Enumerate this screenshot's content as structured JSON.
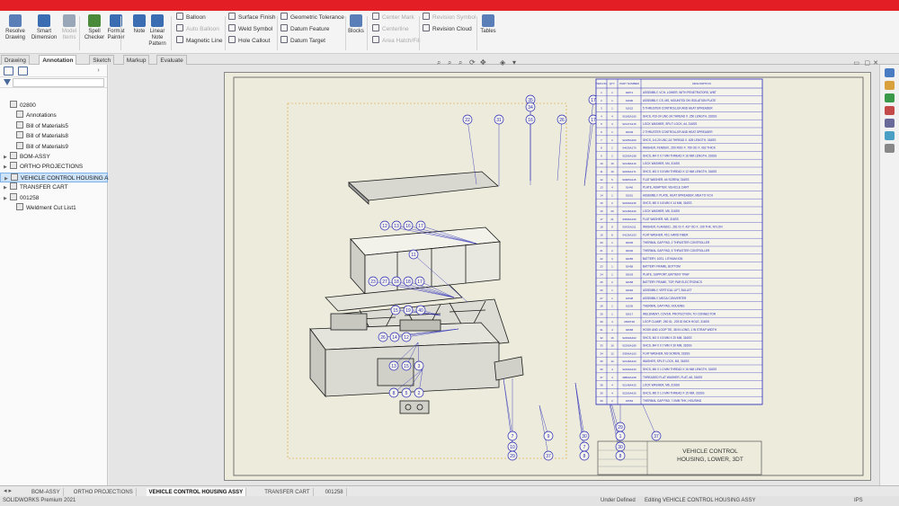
{
  "ribbon": {
    "buttons": [
      {
        "label1": "Resolve",
        "label2": "Drawing",
        "color": "#5a7fb8",
        "icon": "resolve-drawing-icon",
        "disabled": false
      },
      {
        "label1": "Smart",
        "label2": "Dimension",
        "color": "#3b6db3",
        "icon": "smart-dimension-icon",
        "disabled": false
      },
      {
        "label1": "Model",
        "label2": "Items",
        "color": "#9aa7b8",
        "icon": "model-items-icon",
        "disabled": true
      },
      {
        "label1": "Spell",
        "label2": "Checker",
        "color": "#4a8a3a",
        "icon": "spell-checker-icon",
        "disabled": false
      },
      {
        "label1": "Format",
        "label2": "Painter",
        "color": "#3b6db3",
        "icon": "format-painter-icon",
        "disabled": false
      },
      {
        "label1": "Note",
        "label2": "",
        "color": "#3b6db3",
        "icon": "note-icon",
        "disabled": false
      },
      {
        "label1": "Linear Note",
        "label2": "Pattern",
        "color": "#3b6db3",
        "icon": "linear-note-pattern-icon",
        "disabled": false
      }
    ],
    "col1": [
      {
        "label": "Balloon",
        "disabled": false
      },
      {
        "label": "Auto Balloon",
        "disabled": true
      },
      {
        "label": "Magnetic Line",
        "disabled": false
      }
    ],
    "col2": [
      {
        "label": "Surface Finish",
        "disabled": false
      },
      {
        "label": "Weld Symbol",
        "disabled": false
      },
      {
        "label": "Hole Callout",
        "disabled": false
      }
    ],
    "col3": [
      {
        "label": "Geometric Tolerance",
        "disabled": false
      },
      {
        "label": "Datum Feature",
        "disabled": false
      },
      {
        "label": "Datum Target",
        "disabled": false
      }
    ],
    "blocks_label": "Blocks",
    "col4": [
      {
        "label": "Center Mark",
        "disabled": true
      },
      {
        "label": "Centerline",
        "disabled": true
      },
      {
        "label": "Area Hatch/Fill",
        "disabled": true
      }
    ],
    "col5": [
      {
        "label": "Revision Symbol",
        "disabled": true
      },
      {
        "label": "Revision Cloud",
        "disabled": false
      }
    ],
    "tables_label": "Tables"
  },
  "command_tabs": [
    "Drawing",
    "Annotation",
    "Sketch",
    "Markup",
    "Evaluate"
  ],
  "active_command_tab": "Annotation",
  "tree": [
    {
      "label": "02800",
      "icon": "drawing-icon",
      "arrow": "",
      "indent": 0,
      "selected": false
    },
    {
      "label": "Annotations",
      "icon": "annotations-folder-icon",
      "arrow": "",
      "indent": 1,
      "selected": false
    },
    {
      "label": "Bill of Materials5",
      "icon": "bom-icon",
      "arrow": "",
      "indent": 1,
      "selected": false
    },
    {
      "label": "Bill of Materials8",
      "icon": "bom-icon",
      "arrow": "",
      "indent": 1,
      "selected": false
    },
    {
      "label": "Bill of Materials9",
      "icon": "bom-icon",
      "arrow": "",
      "indent": 1,
      "selected": false
    },
    {
      "label": "BOM-ASSY",
      "icon": "sheet-icon",
      "arrow": "▶",
      "indent": 0,
      "selected": false
    },
    {
      "label": "ORTHO PROJECTIONS",
      "icon": "sheet-icon",
      "arrow": "▶",
      "indent": 0,
      "selected": false
    },
    {
      "label": "VEHICLE CONTROL HOUSING ASSY",
      "icon": "sheet-icon",
      "arrow": "▶",
      "indent": 0,
      "selected": true
    },
    {
      "label": "TRANSFER CART",
      "icon": "sheet-icon",
      "arrow": "▶",
      "indent": 0,
      "selected": false
    },
    {
      "label": "001258",
      "icon": "sheet-icon",
      "arrow": "▶",
      "indent": 0,
      "selected": false
    },
    {
      "label": "Weldment Cut List1",
      "icon": "cut-list-icon",
      "arrow": "",
      "indent": 1,
      "selected": false
    }
  ],
  "bom": {
    "headers": [
      "ITEM NO.",
      "QTY.",
      "PART NUMBER",
      "DESCRIPTION"
    ],
    "rows": [
      [
        "1",
        "1",
        "92871",
        "ASSEMBLY, VCH, LOWER, WITH PENETRATORS, WBT"
      ],
      [
        "2",
        "1",
        "91990",
        "ASSEMBLY, CS, MS, MOUNTED ON ISOLATION PLATE"
      ],
      [
        "3",
        "1",
        "91922",
        "5 THRUSTER CONTROLLER AND HEAT SPREADER"
      ],
      [
        "4",
        "4",
        "92185A165",
        "SHCS, #10-24 UNC-2A THREAD X .250 LENGTH, 316SS"
      ],
      [
        "5",
        "4",
        "92147A415",
        "LOCK WASHER, SPLIT LOCK, #4, 316SS"
      ],
      [
        "6",
        "1",
        "92049",
        "2 THRUSTER CONTROLLER AND HEAT SPREADER"
      ],
      [
        "7",
        "2",
        "92185A309",
        "SHCS, 1/4-20 UNC-2A THREAD X .625 LENGTH, 316SS"
      ],
      [
        "8",
        "2",
        "94639A279",
        "WASHER, FENDER, .250 ROD X .750 OD X .062 THICK"
      ],
      [
        "9",
        "2",
        "92290A198",
        "SHCS, M4 X 0.7 MM THREAD X 16 MM LENGTH, 316SS"
      ],
      [
        "10",
        "16",
        "92148A416",
        "LOCK WASHER, M4, 316SS"
      ],
      [
        "11",
        "16",
        "92290A171",
        "SHCS, M3 X 0.5 MM THREAD X 12 MM LENGTH, 316SS"
      ],
      [
        "12",
        "5",
        "90965A115",
        "FLAT WASHER, #4 SCREW, 316SS"
      ],
      [
        "13",
        "4",
        "91440",
        "PLATE, ADAPTER, VEHICLE CART"
      ],
      [
        "14",
        "1",
        "91551",
        "ASSEMBLY, PLATE, HEAT SPREADER, MEA TO VCH"
      ],
      [
        "15",
        "2",
        "92290A236",
        "SHCS, M5 X 0.8 MM X 14 MM, 316SS"
      ],
      [
        "16",
        "20",
        "92148A426",
        "LOCK WASHER, M5, 316SS"
      ],
      [
        "17",
        "21",
        "93996A106",
        "FLAT WASHER, M5, 316SS"
      ],
      [
        "18",
        "8",
        "95435A011",
        "WASHER, FLANGED, .281 ID X .437 OD X .109 THK, NYLON"
      ],
      [
        "19",
        "8",
        "94136A193",
        "FLAT WASHER, #10, HARD FIBER"
      ],
      [
        "20",
        "1",
        "92045",
        "THERMAL GAP PAD, 2 THRUSTER CONTROLLER"
      ],
      [
        "21",
        "2",
        "92046",
        "THERMAL GAP PAD, 5 THRUSTER CONTROLLER"
      ],
      [
        "22",
        "3",
        "92055",
        "BATTERY, 10S1, LITHIUM ION"
      ],
      [
        "23",
        "1",
        "92458",
        "BATTERY FRAME, BOTTOM"
      ],
      [
        "24",
        "1",
        "93003",
        "PLATE, SUPPORT, BATTERY TRAY"
      ],
      [
        "25",
        "2",
        "92058",
        "BATTERY FRAME, TOP, PAR ELECTRONICS"
      ],
      [
        "26",
        "1",
        "92084",
        "ASSEMBLY, VERTICAL LIFT, BULLET"
      ],
      [
        "27",
        "1",
        "91538",
        "ASSEMBLY, MEGA CONVERTER"
      ],
      [
        "28",
        "1",
        "91536",
        "THERMAL GAP PAD, HOUSING"
      ],
      [
        "29",
        "1",
        "92617",
        "WELDMENT, COVER, PROTECTION, TO CONNECTOR"
      ],
      [
        "30",
        "4",
        "2699T48",
        "LOOP CLAMP, .250 ID, .203 ID INCH HOLE, 316SS"
      ],
      [
        "31",
        "4",
        "92668",
        "HOOK AND LOOP TIE, 38 IN LONG, 1 IN STRAP WIDTH"
      ],
      [
        "32",
        "16",
        "92290A402",
        "SHCS, M3 X 0.5 MM X 20 MM, 316SS"
      ],
      [
        "33",
        "16",
        "92290A189",
        "SHCS, M4 X 0.7 MM X 30 MM, 316SS"
      ],
      [
        "34",
        "12",
        "93996A100",
        "FLAT WASHER, M3 SCREW, 316SS"
      ],
      [
        "35",
        "12",
        "92148A420",
        "WASHER, SPLIT LOCK, M3, 316SS"
      ],
      [
        "36",
        "4",
        "92290A433",
        "SHCS, M6 X 1.0 MM THREAD X 16 MM LENGTH, 316SS"
      ],
      [
        "37",
        "4",
        "98800A168",
        "THREADED FLAT WASHER, FLAT, #8, 316SS"
      ],
      [
        "38",
        "4",
        "92148A425",
        "LOCK WASHER, M6, 316SS"
      ],
      [
        "39",
        "4",
        "92290A426",
        "SHCS, M6 X 1.0 MM THREAD X 15 MM, 316SS"
      ],
      [
        "40",
        "2",
        "91562",
        "THERMAL GAP PAD, 7.0MM THK, HOUSING"
      ]
    ]
  },
  "title_block": {
    "line1": "VEHICLE CONTROL",
    "line2": "HOUSING, LOWER, 3DT"
  },
  "balloons": [
    "35",
    "34",
    "17",
    "22",
    "31",
    "16",
    "26",
    "17",
    "12",
    "13",
    "16",
    "17",
    "11",
    "23",
    "27",
    "18",
    "18",
    "17",
    "15",
    "19",
    "40",
    "26",
    "14",
    "12",
    "13",
    "15",
    "3",
    "8",
    "5",
    "2",
    "7",
    "10",
    "9",
    "30",
    "7",
    "8",
    "1",
    "30",
    "8",
    "37",
    "29",
    "37",
    "29"
  ],
  "sheet_tabs": [
    "BOM-ASSY",
    "ORTHO PROJECTIONS",
    "VEHICLE CONTROL HOUSING ASSY",
    "TRANSFER CART",
    "001258"
  ],
  "active_sheet_tab": "VEHICLE CONTROL HOUSING ASSY",
  "status": {
    "app": "SOLIDWORKS Premium 2021",
    "state": "Under Defined",
    "editing": "Editing VEHICLE CONTROL HOUSING ASSY",
    "units": "IPS"
  },
  "colors": {
    "accent_red": "#e31e24",
    "bom_blue": "#2a2ab8",
    "selected": "#cce2f8"
  }
}
